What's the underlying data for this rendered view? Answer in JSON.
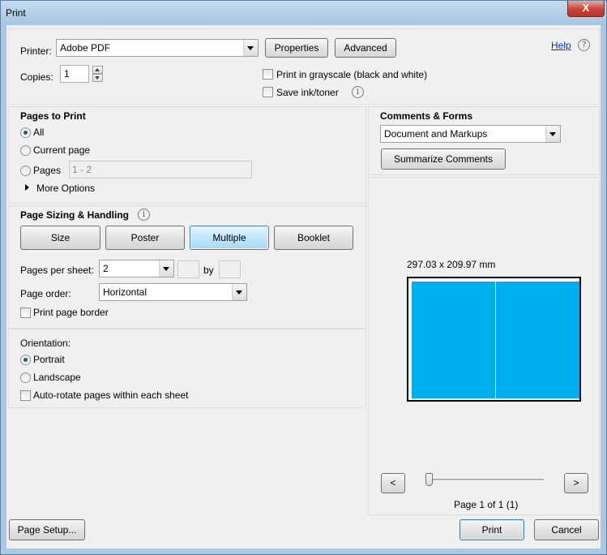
{
  "window": {
    "title": "Print",
    "close_label": "X"
  },
  "header": {
    "printer_label": "Printer:",
    "printer_value": "Adobe PDF",
    "properties_label": "Properties",
    "advanced_label": "Advanced",
    "help_label": "Help",
    "copies_label": "Copies:",
    "copies_value": "1",
    "grayscale_label": "Print in grayscale (black and white)",
    "save_ink_label": "Save ink/toner"
  },
  "pages_to_print": {
    "title": "Pages to Print",
    "all_label": "All",
    "current_page_label": "Current page",
    "pages_label": "Pages",
    "pages_value": "1 - 2",
    "more_options_label": "More Options"
  },
  "page_sizing": {
    "title": "Page Sizing & Handling",
    "size_label": "Size",
    "poster_label": "Poster",
    "multiple_label": "Multiple",
    "booklet_label": "Booklet",
    "pages_per_sheet_label": "Pages per sheet:",
    "pages_per_sheet_value": "2",
    "by_label": "by",
    "page_order_label": "Page order:",
    "page_order_value": "Horizontal",
    "print_border_label": "Print page border"
  },
  "orientation": {
    "title": "Orientation:",
    "portrait_label": "Portrait",
    "landscape_label": "Landscape",
    "autorotate_label": "Auto-rotate pages within each sheet"
  },
  "comments_forms": {
    "title": "Comments & Forms",
    "value": "Document and Markups",
    "summarize_label": "Summarize Comments"
  },
  "preview": {
    "dimensions": "297.03 x 209.97 mm",
    "prev_label": "<",
    "next_label": ">",
    "page_info": "Page 1 of 1 (1)",
    "page_color": "#00aeef"
  },
  "footer": {
    "page_setup_label": "Page Setup...",
    "print_label": "Print",
    "cancel_label": "Cancel"
  }
}
